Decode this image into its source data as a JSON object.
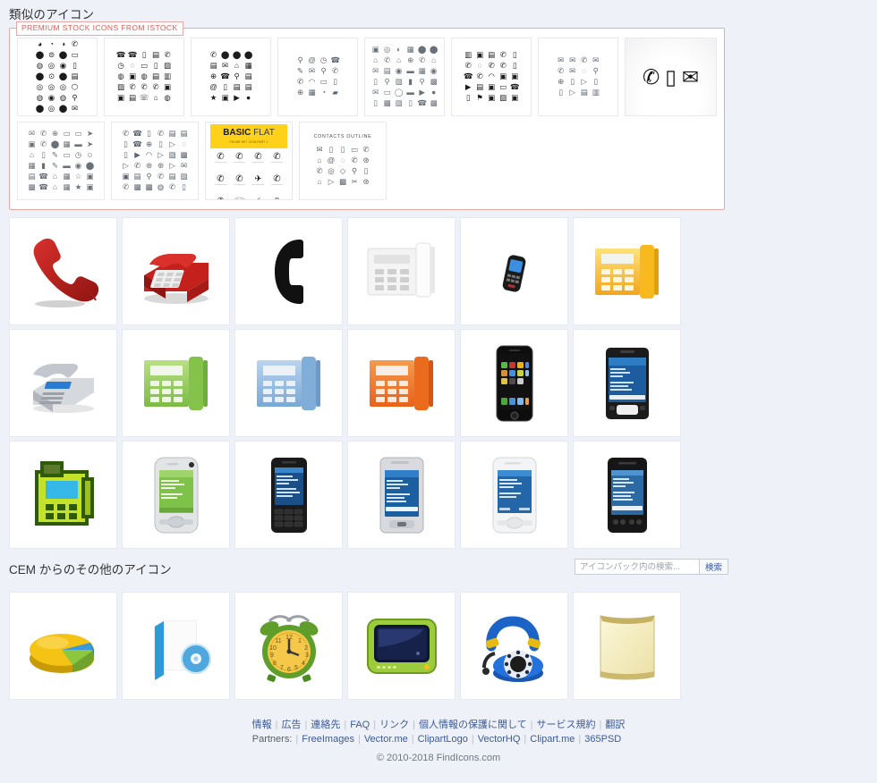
{
  "page": {
    "similar_title": "類似のアイコン",
    "cem_title": "CEM からのその他のアイコン"
  },
  "premium": {
    "legend": "PREMIUM STOCK ICONS FROM ISTOCK",
    "thumbnails": [
      {
        "name": "phone-circles-sheet",
        "style": "solid",
        "columns": 4,
        "glyphs": [
          "◕",
          "◔",
          "◑",
          "✆",
          "⬤",
          "⊜",
          "⬤",
          "▭",
          "◍",
          "◎",
          "◉",
          "▯",
          "⬤",
          "⊙",
          "⬤",
          "▤",
          "◎",
          "◎",
          "◎",
          "⬡",
          "◍",
          "◉",
          "◍",
          "⚲",
          "⬤",
          "◎",
          "⬤",
          "✉"
        ]
      },
      {
        "name": "telephone-mixed-sheet",
        "style": "solid",
        "columns": 5,
        "glyphs": [
          "☎",
          "☎",
          "▯",
          "▤",
          "✆",
          "◷",
          "◌",
          "▭",
          "▯",
          "▨",
          "◍",
          "▣",
          "◍",
          "▤",
          "▥",
          "▨",
          "✆",
          "✆",
          "✆",
          "▣",
          "▣",
          "▤",
          "☏",
          "⌂",
          "◍"
        ]
      },
      {
        "name": "contact-bold-sheet",
        "style": "solid",
        "columns": 4,
        "glyphs": [
          "✆",
          "⬤",
          "⬤",
          "⬤",
          "▤",
          "✉",
          "⌂",
          "▦",
          "⊕",
          "☎",
          "⚲",
          "▤",
          "@",
          "▯",
          "▤",
          "▤",
          "★",
          "▣",
          "▶",
          "●"
        ]
      },
      {
        "name": "contact-outline-sheet",
        "style": "outline",
        "columns": 4,
        "glyphs": [
          "⚲",
          "@",
          "◷",
          "☎",
          "✎",
          "✉",
          "⚲",
          "✆",
          "✆",
          "◠",
          "▭",
          "▯",
          "⊕",
          "▦",
          "◔",
          "▰"
        ]
      },
      {
        "name": "office-gray-sheet",
        "style": "gray",
        "columns": 6,
        "glyphs": [
          "▣",
          "◎",
          "◐",
          "▦",
          "⬤",
          "⬤",
          "⌂",
          "✆",
          "⌂",
          "⊕",
          "✆",
          "⌂",
          "✉",
          "▤",
          "◉",
          "▬",
          "▦",
          "◉",
          "▯",
          "⚲",
          "▨",
          "▮",
          "⚲",
          "▩",
          "✉",
          "▭",
          "◯",
          "▬",
          "▶",
          "●",
          "▯",
          "▩",
          "▨",
          "▯",
          "☎",
          "▩"
        ]
      },
      {
        "name": "devices-sheet",
        "style": "solid",
        "columns": 5,
        "glyphs": [
          "▥",
          "▣",
          "▤",
          "✆",
          "▯",
          "✆",
          "◌",
          "✆",
          "✆",
          "▯",
          "☎",
          "✆",
          "◠",
          "▣",
          "▣",
          "▶",
          "▤",
          "▣",
          "▭",
          "☎",
          "▯",
          "⚑",
          "▣",
          "▨",
          "▣"
        ]
      },
      {
        "name": "mail-outline-sheet",
        "style": "outline",
        "columns": 4,
        "glyphs": [
          "✉",
          "✉",
          "✆",
          "✉",
          "✆",
          "✉",
          "◌",
          "⚲",
          "⊕",
          "▯",
          "▷",
          "▯",
          "▯",
          "▷",
          "▤",
          "▥"
        ]
      },
      {
        "name": "contact-hero-banner",
        "style": "hero",
        "glyphs": [
          "✆",
          "▯",
          "✉"
        ]
      }
    ],
    "thumbnails_row2": [
      {
        "name": "communication-mini-sheet",
        "style": "gray",
        "columns": 6,
        "glyphs": [
          "✉",
          "✆",
          "⊕",
          "▭",
          "▭",
          "➤",
          "▣",
          "✆",
          "⬤",
          "▦",
          "▬",
          "➤",
          "⌂",
          "▯",
          "✎",
          "▭",
          "◷",
          "☺",
          "▦",
          "▮",
          "✎",
          "▬",
          "◉",
          "⬤",
          "▤",
          "☎",
          "⌂",
          "▦",
          "☆",
          "▣",
          "▩",
          "☎",
          "⌂",
          "▦",
          "★",
          "▣"
        ]
      },
      {
        "name": "thin-line-sheet",
        "style": "outline",
        "columns": 6,
        "glyphs": [
          "✆",
          "☎",
          "▯",
          "✆",
          "▤",
          "▤",
          "▯",
          "☎",
          "⊕",
          "▯",
          "▷",
          "◌",
          "▯",
          "▶",
          "◠",
          "▷",
          "▨",
          "▩",
          "▷",
          "✆",
          "⊛",
          "⊛",
          "▷",
          "✉",
          "▣",
          "▤",
          "⚲",
          "✆",
          "▤",
          "▨",
          "✆",
          "▩",
          "▩",
          "◍",
          "✆",
          "▯"
        ]
      },
      {
        "name": "basic-flat-banner",
        "style": "basicflat",
        "banner_bold": "BASIC",
        "banner_light": "FLAT",
        "banner_sub": "PHONE SET ICON PART 1",
        "glyphs": [
          "✆",
          "✆",
          "✆",
          "✆",
          "✆",
          "✆",
          "✈",
          "✆",
          "✆",
          "☏",
          "⚡",
          "▯"
        ]
      },
      {
        "name": "contacts-outline-sheet",
        "style": "outline",
        "title": "CONTACTS  OUTLINE",
        "columns": 5,
        "glyphs": [
          "✉",
          "▯",
          "▯",
          "▭",
          "✆",
          "⌂",
          "@",
          "◌",
          "✆",
          "⊛",
          "✆",
          "◎",
          "◇",
          "⚲",
          "▯",
          "⌂",
          "▷",
          "▩",
          "✂",
          "⊛"
        ]
      }
    ]
  },
  "similar_icons": [
    {
      "name": "red-handset-icon",
      "label": "red handset"
    },
    {
      "name": "red-desk-phone-icon",
      "label": "red desk phone"
    },
    {
      "name": "black-handset-icon",
      "label": "black handset"
    },
    {
      "name": "white-office-phone-icon",
      "label": "white office phone"
    },
    {
      "name": "blue-cellphone-icon",
      "label": "blue cellphone"
    },
    {
      "name": "yellow-office-phone-icon",
      "label": "yellow office phone"
    },
    {
      "name": "gray-desk-phone-icon",
      "label": "gray desk phone"
    },
    {
      "name": "green-office-phone-icon",
      "label": "green office phone"
    },
    {
      "name": "blue-office-phone-icon",
      "label": "blue office phone"
    },
    {
      "name": "orange-office-phone-icon",
      "label": "orange office phone"
    },
    {
      "name": "iphone-icon",
      "label": "iPhone"
    },
    {
      "name": "black-pda-icon",
      "label": "black PDA"
    },
    {
      "name": "green-pixel-phone-icon",
      "label": "green pixel phone"
    },
    {
      "name": "silver-pda-green-screen-icon",
      "label": "silver PDA green screen"
    },
    {
      "name": "black-slider-phone-icon",
      "label": "black slider phone"
    },
    {
      "name": "silver-pocket-pc-icon",
      "label": "silver pocket PC"
    },
    {
      "name": "white-pda-icon",
      "label": "white PDA"
    },
    {
      "name": "dark-pda-icon",
      "label": "dark PDA"
    }
  ],
  "cem_icons": [
    {
      "name": "pie-chart-icon",
      "label": "pie chart"
    },
    {
      "name": "software-box-cd-icon",
      "label": "software box with CD"
    },
    {
      "name": "alarm-clock-icon",
      "label": "alarm clock"
    },
    {
      "name": "television-icon",
      "label": "television"
    },
    {
      "name": "blue-rotary-phone-icon",
      "label": "blue rotary phone"
    },
    {
      "name": "parchment-note-icon",
      "label": "parchment note"
    }
  ],
  "search": {
    "placeholder": "アイコンパック内の検索...",
    "value": "",
    "button_label": "検索"
  },
  "footer": {
    "links": [
      "情報",
      "広告",
      "連絡先",
      "FAQ",
      "リンク",
      "個人情報の保護に関して",
      "サービス規約",
      "翻訳"
    ],
    "partners_label": "Partners:",
    "partners": [
      "FreeImages",
      "Vector.me",
      "ClipartLogo",
      "VectorHQ",
      "Clipart.me",
      "365PSD"
    ],
    "copyright": "© 2010-2018 FindIcons.com"
  },
  "colors": {
    "background": "#eef2f8",
    "card_border": "#e6e9ef",
    "premium_border": "#e8a9a5",
    "premium_text": "#e15b55",
    "link": "#3b5998",
    "accent_yellow": "#ffd11a"
  }
}
